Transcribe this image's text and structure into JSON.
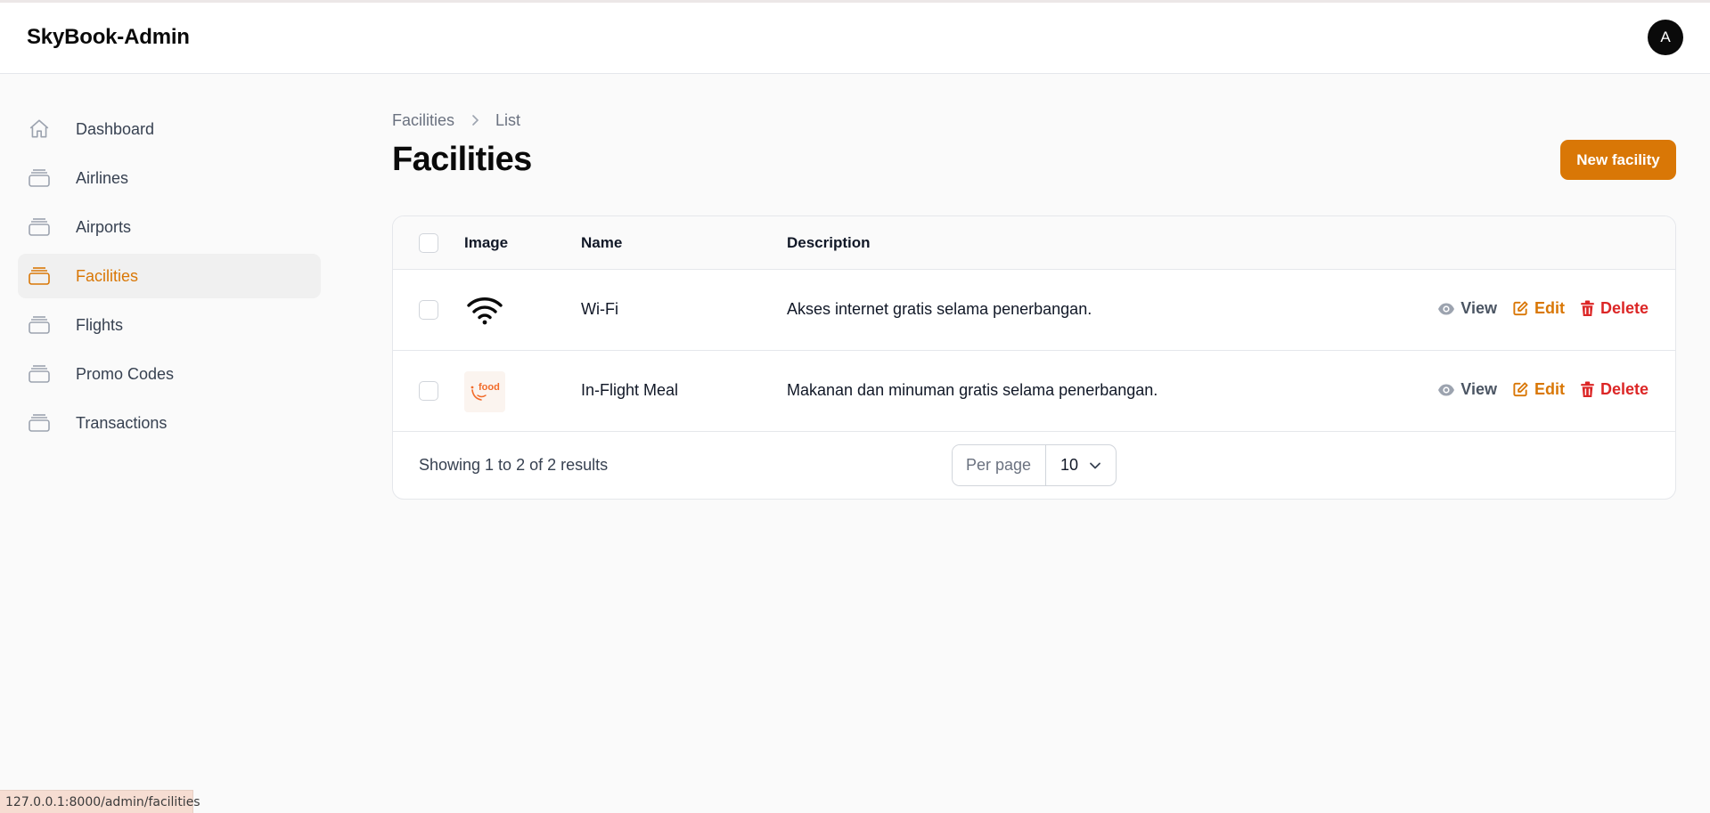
{
  "app": {
    "brand": "SkyBook-Admin",
    "avatar_initial": "A"
  },
  "sidebar": {
    "items": [
      {
        "label": "Dashboard",
        "icon": "home-icon",
        "active": false
      },
      {
        "label": "Airlines",
        "icon": "stack-icon",
        "active": false
      },
      {
        "label": "Airports",
        "icon": "stack-icon",
        "active": false
      },
      {
        "label": "Facilities",
        "icon": "stack-icon",
        "active": true
      },
      {
        "label": "Flights",
        "icon": "stack-icon",
        "active": false
      },
      {
        "label": "Promo Codes",
        "icon": "stack-icon",
        "active": false
      },
      {
        "label": "Transactions",
        "icon": "stack-icon",
        "active": false
      }
    ]
  },
  "breadcrumb": {
    "items": [
      "Facilities",
      "List"
    ]
  },
  "page": {
    "title": "Facilities",
    "new_button": "New facility"
  },
  "table": {
    "headers": {
      "image": "Image",
      "name": "Name",
      "description": "Description"
    },
    "rows": [
      {
        "image": "wifi-icon",
        "name": "Wi-Fi",
        "description": "Akses internet gratis selama penerbangan."
      },
      {
        "image": "food-logo",
        "image_text": "food",
        "name": "In-Flight Meal",
        "description": "Makanan dan minuman gratis selama penerbangan."
      }
    ],
    "actions": {
      "view": "View",
      "edit": "Edit",
      "delete": "Delete"
    }
  },
  "pagination": {
    "results_text": "Showing 1 to 2 of 2 results",
    "per_page_label": "Per page",
    "per_page_value": "10"
  },
  "statusbar": {
    "url": "127.0.0.1:8000/admin/facilities"
  },
  "colors": {
    "accent": "#d97706",
    "danger": "#dc2626",
    "muted": "#4b5563",
    "brand_dark": "#0a0a0a"
  }
}
